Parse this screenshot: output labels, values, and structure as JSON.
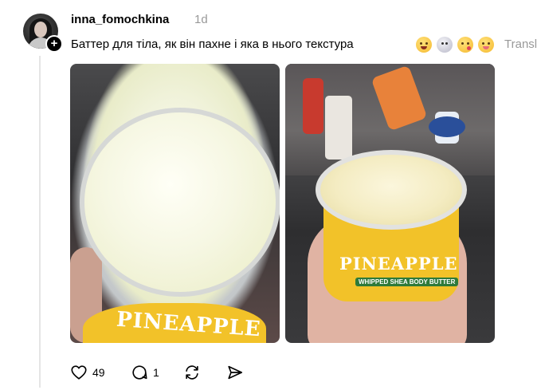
{
  "post": {
    "username": "inna_fomochkina",
    "time": "1d",
    "text": "Баттер для тіла, як він пахне і яка в нього текстура",
    "emojis": [
      "smiling-face-emoji",
      "ghost-emoji",
      "face-blowing-kiss-emoji",
      "squinting-tongue-emoji"
    ],
    "translate_label": "Transl",
    "follow_badge": "+",
    "photos": [
      {
        "name": "photo-open-jar-closeup",
        "label": "PINEAPPLE"
      },
      {
        "name": "photo-jar-in-hand",
        "label": "PINEAPPLE",
        "sublabel": "WHIPPED SHEA BODY BUTTER"
      }
    ]
  },
  "actions": {
    "likes": "49",
    "replies": "1"
  },
  "colors": {
    "text": "#000000",
    "muted": "#999999",
    "thread_line": "#e5e5e5",
    "label_yellow": "#f2c229"
  }
}
